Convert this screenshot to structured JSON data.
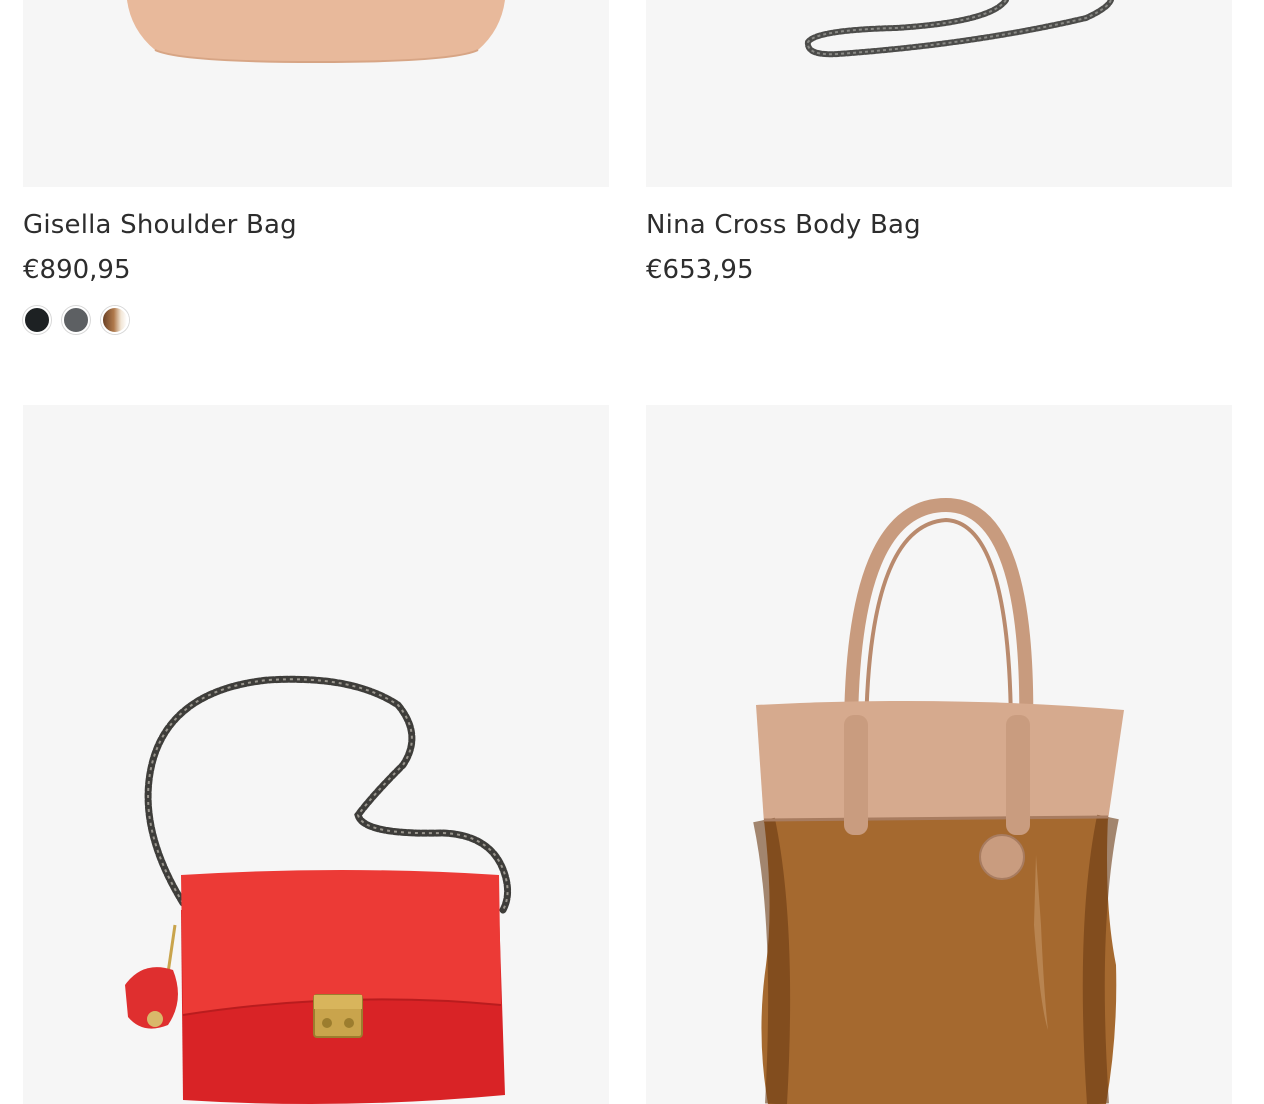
{
  "products": [
    {
      "name": "Gisella Shoulder Bag",
      "price": "€890,95",
      "image": "beige-leather-shoulder-bag",
      "swatches": [
        {
          "name": "black",
          "color": "#1d2123"
        },
        {
          "name": "grey",
          "color": "#5d6063"
        },
        {
          "name": "brown-fur",
          "color": "#8a5a36"
        }
      ]
    },
    {
      "name": "Nina Cross Body Bag",
      "price": "€653,95",
      "image": "chain-strap-cross-body-bag"
    },
    {
      "image": "red-leather-cross-body-bag-with-chain"
    },
    {
      "image": "beige-and-springbok-fur-tote-bag"
    }
  ],
  "colors": {
    "image_background": "#f6f6f6",
    "text": "#2d2d2d",
    "bag_beige": "#e9b99a",
    "bag_red": "#e32b2b",
    "fur_brown": "#a5692f"
  }
}
